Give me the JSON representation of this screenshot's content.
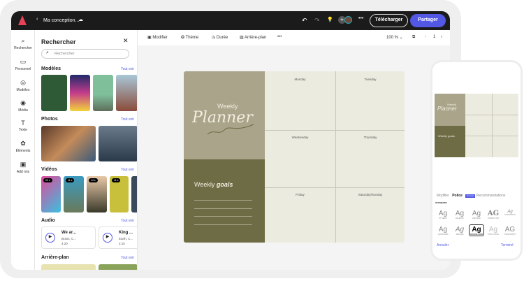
{
  "app": {
    "title": "Ma conception...",
    "download": "Télécharger",
    "share": "Partager"
  },
  "rail": [
    {
      "label": "Rechercher",
      "icon": "search-icon"
    },
    {
      "label": "Personnel",
      "icon": "folder-icon"
    },
    {
      "label": "Modèles",
      "icon": "templates-icon"
    },
    {
      "label": "Média",
      "icon": "media-icon"
    },
    {
      "label": "Texte",
      "icon": "text-icon"
    },
    {
      "label": "Éléments",
      "icon": "elements-icon"
    },
    {
      "label": "Add ons",
      "icon": "addons-icon"
    }
  ],
  "panel": {
    "title": "Rechercher",
    "search_placeholder": "Rechercher",
    "see_all": "Tout voir",
    "sections": {
      "templates": "Modèles",
      "photos": "Photos",
      "videos": "Vidéos",
      "audio": "Audio",
      "backgrounds": "Arrière-plan"
    },
    "video_durations": [
      "20 s",
      "11 s",
      "14 s",
      "11 s"
    ],
    "audio": [
      {
        "title": "We ar...",
        "artist": "Brass, C...",
        "duration": "4:20"
      },
      {
        "title": "King ...",
        "artist": "Earth, C...",
        "duration": "2:15"
      }
    ]
  },
  "toolbar": {
    "modify": "Modifier",
    "theme": "Thème",
    "duration": "Durée",
    "background": "Arrière-plan",
    "zoom": "100 %",
    "page": "1"
  },
  "planner": {
    "title_small": "Weekly",
    "title_big": "Planner",
    "goals_a": "Weekly",
    "goals_b": "goals",
    "days": [
      "Monday",
      "Tuesday",
      "Wednesday",
      "Thursday",
      "Friday",
      "Saturday/Sunday"
    ],
    "colors": {
      "top": "#a9a48a",
      "bottom": "#6e6c45",
      "grid": "#ecebe0"
    }
  },
  "phone": {
    "tabs": [
      "Modifier",
      "Police",
      "Recommandations"
    ],
    "badge": "Nouveau",
    "section": "STANDARD",
    "fonts": [
      "PT SERIF",
      "RALEWAY",
      "GROTESK",
      "STENCIL STD",
      "STORYBOOK",
      "QUICKSAND",
      "SEASIDE",
      "SOURCE SANS",
      "STINT ULTRA",
      "TRUE NORTH"
    ],
    "cancel": "Annuler",
    "done": "Terminé",
    "mini": {
      "weekly": "Weekly",
      "planner": "Planner",
      "goals": "Weekly goals"
    }
  },
  "colors": {
    "accent": "#5258e4",
    "topbar": "#1b1b1b"
  }
}
